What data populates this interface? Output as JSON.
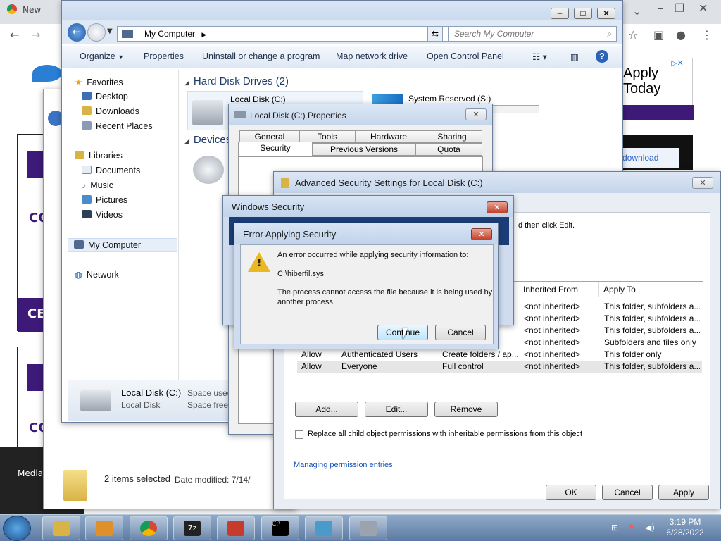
{
  "browser": {
    "tab_label": "New",
    "ad_texts": [
      "Apply",
      "Today"
    ],
    "download_link": "download",
    "left_ad_texts": [
      "CO",
      "CE",
      "CO"
    ],
    "bottom_ad": "Media to our"
  },
  "explorer": {
    "address": "My Computer",
    "search_placeholder": "Search My Computer",
    "commands": [
      "Organize",
      "Properties",
      "Uninstall or change a program",
      "Map network drive",
      "Open Control Panel"
    ],
    "nav": {
      "favorites": "Favorites",
      "desktop": "Desktop",
      "downloads": "Downloads",
      "recent": "Recent Places",
      "libraries": "Libraries",
      "documents": "Documents",
      "music": "Music",
      "pictures": "Pictures",
      "videos": "Videos",
      "computer": "My Computer",
      "network": "Network"
    },
    "group_hdd": "Hard Disk Drives (2)",
    "group_devices": "Devices",
    "drive_c": "Local Disk (C:)",
    "drive_s": "System Reserved (S:)",
    "details": {
      "name": "Local Disk (C:)",
      "type": "Local Disk",
      "space_used_label": "Space used:",
      "space_free_label": "Space free:"
    }
  },
  "explorer2": {
    "status": "2 items selected",
    "date_modified": "Date modified: 7/14/"
  },
  "props": {
    "title": "Local Disk (C:) Properties",
    "tabs_row1": [
      "General",
      "Tools",
      "Hardware",
      "Sharing"
    ],
    "tabs_row2": [
      "Security",
      "Previous Versions",
      "Quota"
    ]
  },
  "adv": {
    "title": "Advanced Security Settings for Local Disk (C:)",
    "instruction_tail": "d then click Edit.",
    "columns": [
      "Inherited From",
      "Apply To"
    ],
    "rows": [
      {
        "type": "",
        "name": "",
        "perm": "",
        "inherited": "<not inherited>",
        "apply": "This folder, subfolders a..."
      },
      {
        "type": "",
        "name": "",
        "perm": "",
        "inherited": "<not inherited>",
        "apply": "This folder, subfolders a..."
      },
      {
        "type": "",
        "name": "",
        "perm": "",
        "inherited": "<not inherited>",
        "apply": "This folder, subfolders a..."
      },
      {
        "type": "",
        "name": "",
        "perm": "",
        "inherited": "<not inherited>",
        "apply": "Subfolders and files only"
      },
      {
        "type": "Allow",
        "name": "Authenticated Users",
        "perm": "Create folders / ap...",
        "inherited": "<not inherited>",
        "apply": "This folder only"
      },
      {
        "type": "Allow",
        "name": "Everyone",
        "perm": "Full control",
        "inherited": "<not inherited>",
        "apply": "This folder, subfolders a..."
      }
    ],
    "add": "Add...",
    "edit": "Edit...",
    "remove": "Remove",
    "replace_checkbox": "Replace all child object permissions with inheritable permissions from this object",
    "link": "Managing permission entries",
    "ok": "OK",
    "cancel": "Cancel",
    "apply": "Apply"
  },
  "winsec": {
    "title": "Windows Security"
  },
  "error": {
    "title": "Error Applying Security",
    "line1": "An error occurred while applying security information to:",
    "path": "C:\\hiberfil.sys",
    "line2": "The process cannot access the file because it is being used by",
    "line3": "another process.",
    "continue": "Continue",
    "cancel": "Cancel"
  },
  "taskbar": {
    "time": "3:19 PM",
    "date": "6/28/2022",
    "apps": [
      "explorer-app",
      "media-player-app",
      "chrome-app",
      "7zip-app",
      "toolbox-app",
      "cmd-app",
      "network-app",
      "drive-app"
    ]
  },
  "colors": {
    "accent_blue": "#1c3e78",
    "close_red": "#c2402a",
    "ad_purple": "#3d1a78"
  }
}
